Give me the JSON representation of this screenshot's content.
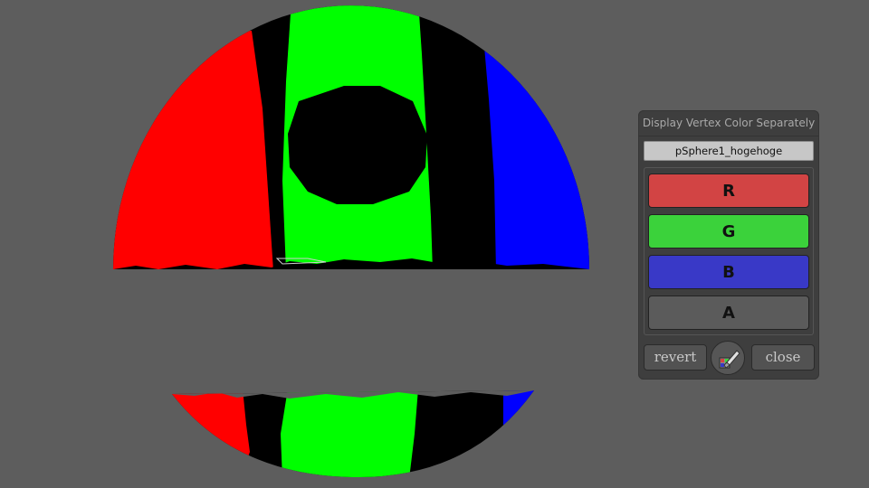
{
  "panel": {
    "title": "Display Vertex Color Separately",
    "object_name": "pSphere1_hogehoge",
    "channels": [
      {
        "label": "R",
        "color": "#d24444"
      },
      {
        "label": "G",
        "color": "#3bd23b"
      },
      {
        "label": "B",
        "color": "#3939c7"
      },
      {
        "label": "A",
        "color": "#5b5b5b"
      }
    ],
    "revert_label": "revert",
    "close_label": "close",
    "tool_icon": "paint-brush-icon"
  },
  "viewport": {
    "background": "#5d5d5d",
    "mesh_colors": {
      "red": "#ff0000",
      "green": "#00ff00",
      "blue": "#0000ff",
      "black": "#000000"
    }
  }
}
